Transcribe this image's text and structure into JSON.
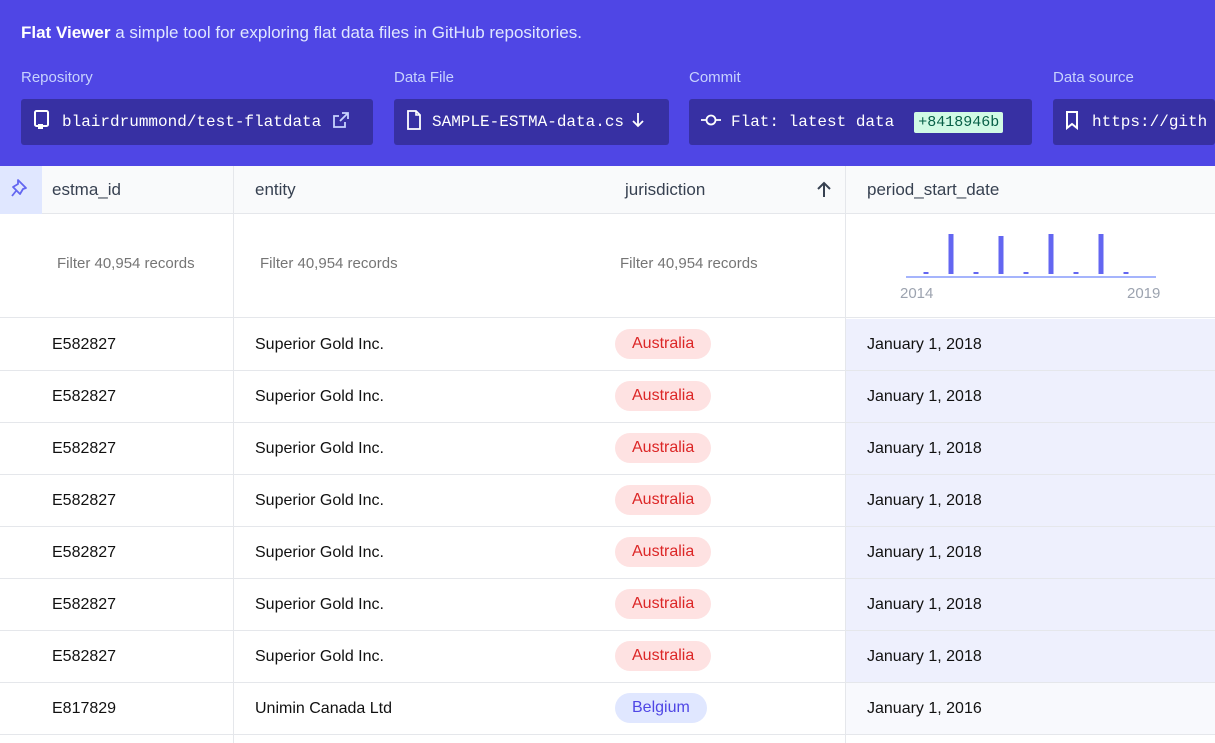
{
  "header": {
    "brand": "Flat Viewer",
    "tagline": "a simple tool for exploring flat data files in GitHub repositories.",
    "repository": {
      "label": "Repository",
      "value": "blairdrummond/test-flatdata"
    },
    "data_file": {
      "label": "Data File",
      "value": "SAMPLE-ESTMA-data.cs"
    },
    "commit": {
      "label": "Commit",
      "message": "Flat: latest data",
      "sha": "+8418946b"
    },
    "data_source": {
      "label": "Data source",
      "value": "https://gith"
    }
  },
  "table": {
    "columns": [
      "estma_id",
      "entity",
      "jurisdiction",
      "period_start_date"
    ],
    "filter_placeholder": "Filter 40,954 records",
    "sort": {
      "column": "jurisdiction",
      "direction": "ascending"
    },
    "histogram": {
      "axis_start": "2014",
      "axis_end": "2019",
      "bars": [
        0.05,
        1.0,
        0.05,
        0.95,
        0.05,
        1.0,
        0.05,
        1.0,
        0.05
      ],
      "color": "#6366f1"
    },
    "rows": [
      {
        "estma_id": "E582827",
        "entity": "Superior Gold Inc.",
        "jurisdiction": "Australia",
        "period_start_date": "January 1, 2018",
        "badge": "red"
      },
      {
        "estma_id": "E582827",
        "entity": "Superior Gold Inc.",
        "jurisdiction": "Australia",
        "period_start_date": "January 1, 2018",
        "badge": "red"
      },
      {
        "estma_id": "E582827",
        "entity": "Superior Gold Inc.",
        "jurisdiction": "Australia",
        "period_start_date": "January 1, 2018",
        "badge": "red"
      },
      {
        "estma_id": "E582827",
        "entity": "Superior Gold Inc.",
        "jurisdiction": "Australia",
        "period_start_date": "January 1, 2018",
        "badge": "red"
      },
      {
        "estma_id": "E582827",
        "entity": "Superior Gold Inc.",
        "jurisdiction": "Australia",
        "period_start_date": "January 1, 2018",
        "badge": "red"
      },
      {
        "estma_id": "E582827",
        "entity": "Superior Gold Inc.",
        "jurisdiction": "Australia",
        "period_start_date": "January 1, 2018",
        "badge": "red"
      },
      {
        "estma_id": "E582827",
        "entity": "Superior Gold Inc.",
        "jurisdiction": "Australia",
        "period_start_date": "January 1, 2018",
        "badge": "red"
      },
      {
        "estma_id": "E817829",
        "entity": "Unimin Canada Ltd",
        "jurisdiction": "Belgium",
        "period_start_date": "January 1, 2016",
        "badge": "blue"
      }
    ]
  }
}
